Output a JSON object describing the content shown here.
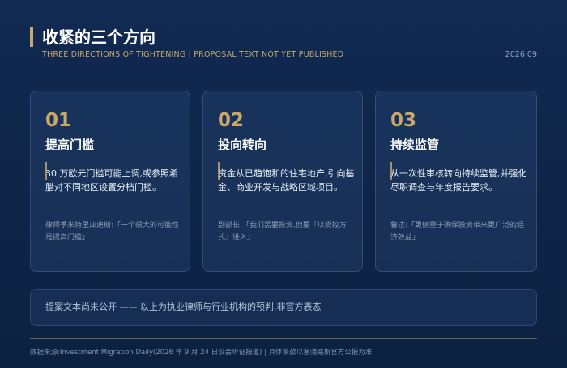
{
  "header": {
    "title": "收紧的三个方向",
    "subtitle": "THREE DIRECTIONS OF TIGHTENING  |  PROPOSAL TEXT NOT YET PUBLISHED",
    "date": "2026.09"
  },
  "cards": [
    {
      "number": "01",
      "title": "提高门槛",
      "body": "30 万欧元门槛可能上调,或参照希腊对不同地区设置分档门槛。",
      "quote": "律师季米特里亚迪斯:「一个很大的可能性是提高门槛」"
    },
    {
      "number": "02",
      "title": "投向转向",
      "body": "资金从已趋饱和的住宅地产,引向基金、商业开发与战略区域项目。",
      "quote": "副部长:「我们需要投资,但要『以受控方式』进入」"
    },
    {
      "number": "03",
      "title": "持续监管",
      "body": "从一次性审核转向持续监管,并强化尽职调查与年度报告要求。",
      "quote": "鲁达:「更侧重于确保投资带来更广泛的经济效益」"
    }
  ],
  "notice": {
    "text": "提案文本尚未公开 —— 以上为执业律师与行业机构的预判,非官方表态"
  },
  "footer": {
    "text": "数据来源:Investment Migration Daily(2026 年 9 月 24 日议会听证报道) | 具体条款以塞浦路斯官方公报为准"
  },
  "colors": {
    "accent": "#c9a86a",
    "background": "#0f2548"
  }
}
